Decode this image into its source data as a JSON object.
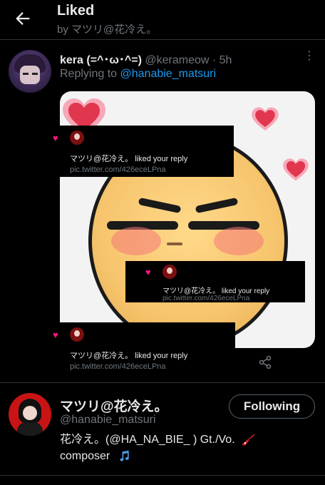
{
  "header": {
    "title": "Liked",
    "subtitle": "by マツリ@花冷え。"
  },
  "tweet": {
    "name": "kera (=^･ω･^=)",
    "handle": "@kerameow",
    "separator": "·",
    "time": "5h",
    "replying_prefix": "Replying to",
    "replying_to": "@hanabie_matsuri",
    "more_icon": "more-dots-icon",
    "share_icon": "share-icon"
  },
  "notifications": [
    {
      "text": "マツリ@花冷え。  liked your reply",
      "link": "pic.twitter.com/426eceLPna"
    },
    {
      "text": "マツリ@花冷え。  liked your reply",
      "link": "pic.twitter.com/426eceLPna"
    },
    {
      "text": "マツリ@花冷え。  liked your reply",
      "link": "pic.twitter.com/426eceLPna"
    }
  ],
  "profile": {
    "name": "マツリ@花冷え。",
    "handle": "@hanabie_matsuri",
    "follow_label": "Following",
    "bio_line1": "花冷え。(@HA_NA_BIE_ ) Gt./Vo.",
    "bio_line2": "composer"
  },
  "colors": {
    "background": "#000000",
    "link": "#1d9bf0",
    "like": "#f91880",
    "muted": "#71767b",
    "text": "#e7e9ea"
  }
}
